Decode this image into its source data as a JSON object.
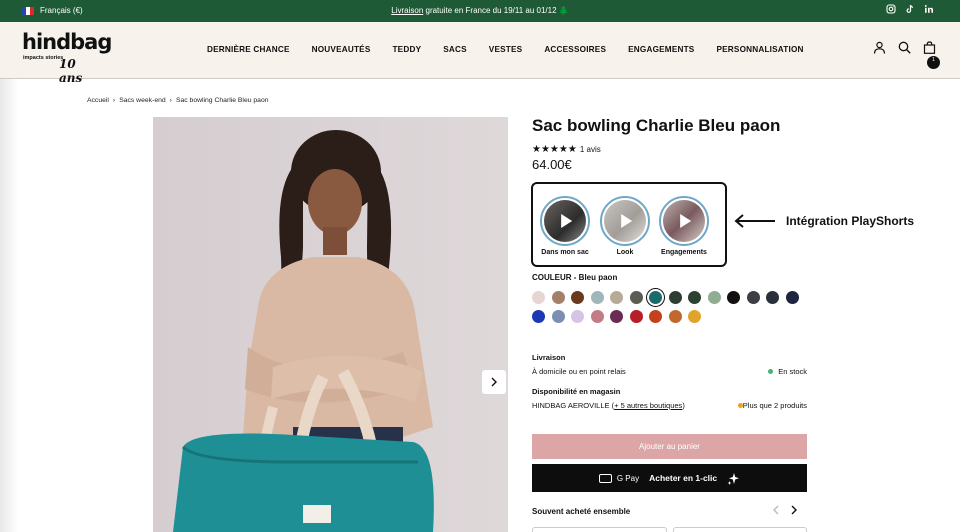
{
  "topbar": {
    "language": "Français (€)",
    "promo_link": "Livraison",
    "promo_rest": " gratuite en France du 19/11 au 01/12 🌲",
    "social": [
      "instagram-icon",
      "tiktok-icon",
      "linkedin-icon"
    ]
  },
  "header": {
    "brand": "hindbag",
    "brand_tagline": "impacts stories",
    "brand_anniversary": "10 ans",
    "nav": [
      "DERNIÈRE CHANCE",
      "NOUVEAUTÉS",
      "TEDDY",
      "SACS",
      "VESTES",
      "ACCESSOIRES",
      "ENGAGEMENTS",
      "PERSONNALISATION"
    ],
    "cart_count": "1"
  },
  "breadcrumb": [
    "Accueil",
    "Sacs week-end",
    "Sac bowling Charlie Bleu paon"
  ],
  "product": {
    "title": "Sac bowling Charlie Bleu paon",
    "stars": "★★★★★",
    "reviews": "1 avis",
    "price": "64.00€",
    "color_label": "COULEUR - Bleu paon"
  },
  "stories": [
    {
      "label": "Dans mon sac"
    },
    {
      "label": "Look"
    },
    {
      "label": "Engagements"
    }
  ],
  "annotation": "Intégration PlayShorts",
  "swatches": {
    "colors": [
      "#e6d6d2",
      "#a4806a",
      "#6a3a1e",
      "#9fb7b9",
      "#b7ab98",
      "#5a5e52",
      "#1a6c6a",
      "#2e3d32",
      "#2b4232",
      "#8fad90",
      "#111111",
      "#3c3f44",
      "#2a2f3c",
      "#1d2440",
      "#1c38b4",
      "#7a8fb2",
      "#d6c4e8",
      "#c27c86",
      "#6a2c54",
      "#b71f27",
      "#c4411c",
      "#c2682e",
      "#e2a32b"
    ],
    "selected_index": 6
  },
  "delivery": {
    "heading": "Livraison",
    "method": "À domicile ou en point relais",
    "status": "En stock",
    "status_color": "#4caf7a"
  },
  "store": {
    "heading": "Disponibilité en magasin",
    "store_name": "HINDBAG AEROVILLE",
    "store_open": " (",
    "other_stores": "+ 5 autres boutiques",
    "store_close": ")",
    "status": "Plus que 2 produits",
    "status_color": "#f0a020"
  },
  "buttons": {
    "add_to_cart": "Ajouter au panier",
    "gpay": "G Pay",
    "one_click": "Acheter en 1-clic"
  },
  "often_bought": "Souvent acheté ensemble"
}
